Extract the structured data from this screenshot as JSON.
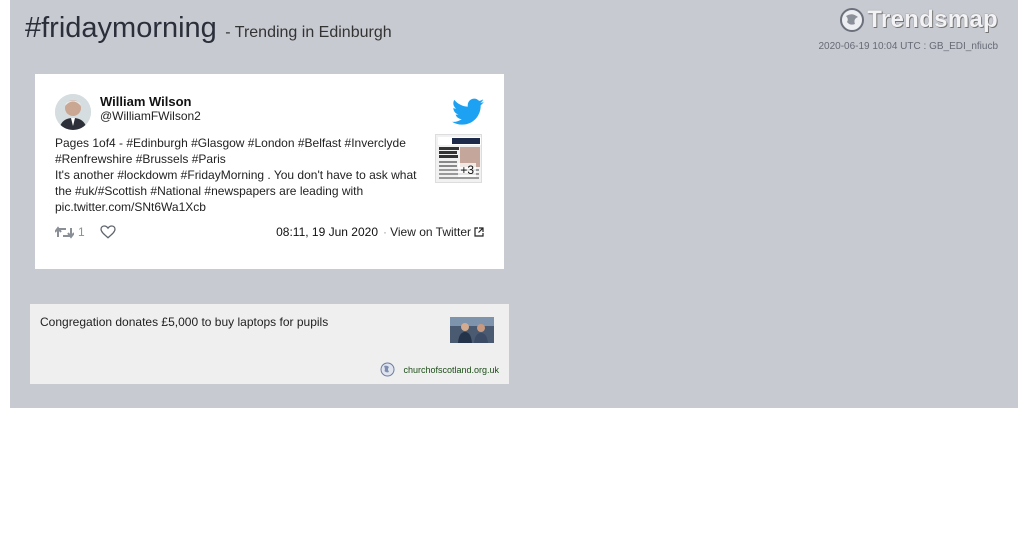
{
  "header": {
    "hashtag": "#fridaymorning",
    "subtitle": "- Trending in Edinburgh",
    "brand": "Trendsmap",
    "meta": "2020-06-19 10:04 UTC : GB_EDI_nfiucb"
  },
  "tweet": {
    "author_name": "William Wilson",
    "author_handle": "@WilliamFWilson2",
    "text_lines": [
      "Pages 1of4 - #Edinburgh #Glasgow #London #Belfast #Inverclyde",
      "#Renfrewshire #Brussels #Paris",
      "It's another #lockdowm #FridayMorning . You don't have to ask what",
      "the #uk/#Scottish #National #newspapers are leading with",
      "pic.twitter.com/SNt6Wa1Xcb"
    ],
    "media_extra": "+3",
    "retweet_count": "1",
    "timestamp": "08:11, 19 Jun 2020",
    "separator": "·",
    "view_label": "View on Twitter",
    "icons": [
      "retweet-icon",
      "heart-icon",
      "twitter-bird-icon",
      "external-link-icon"
    ],
    "colors": {
      "twitter_blue": "#1da1f2",
      "muted": "#8a8f96"
    }
  },
  "article": {
    "title": "Congregation donates £5,000 to buy laptops for pupils",
    "source": "churchofscotland.org.uk",
    "icons": [
      "globe-icon"
    ],
    "colors": {
      "source_link": "#1c4d16"
    }
  },
  "theme": {
    "panel_bg": "#c8cad2",
    "card_bg": "#ffffff",
    "article_bg": "#efeff0"
  }
}
